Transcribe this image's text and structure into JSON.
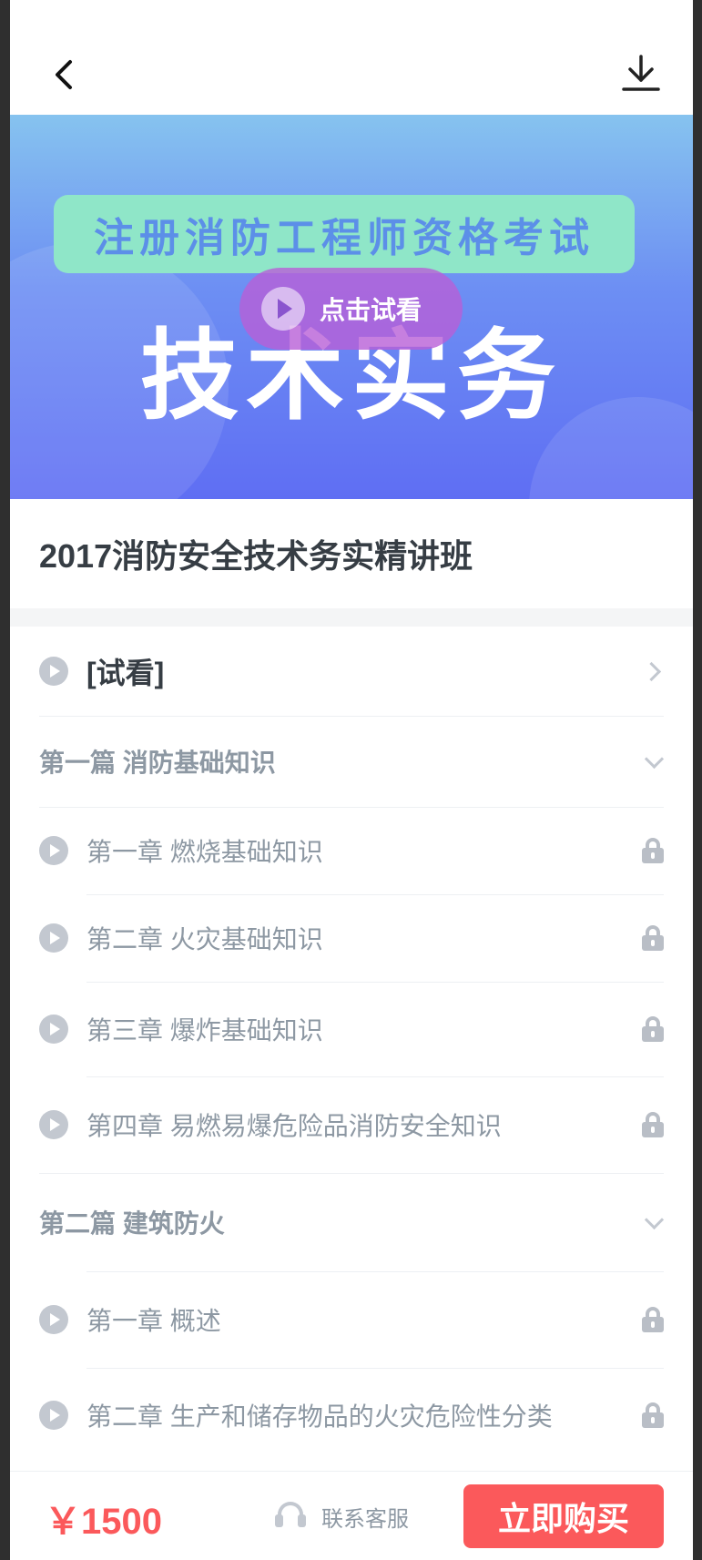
{
  "header": {
    "back_icon": "chevron-left-icon",
    "download_icon": "download-icon"
  },
  "banner": {
    "top_text": "注册消防工程师资格考试",
    "big_text": "技术实务",
    "trial_label": "点击试看",
    "trial_icon": "play-icon"
  },
  "course": {
    "title": "2017消防安全技术务实精讲班"
  },
  "list": {
    "trial_item": "[试看]",
    "part1": "第一篇  消防基础知识",
    "part1_ch1": "第一章  燃烧基础知识",
    "part1_ch2": "第二章  火灾基础知识",
    "part1_ch3": "第三章  爆炸基础知识",
    "part1_ch4": "第四章  易燃易爆危险品消防安全知识",
    "part2": "第二篇  建筑防火",
    "part2_ch1": "第一章  概述",
    "part2_ch2": "第二章  生产和储存物品的火灾危险性分类"
  },
  "bottom": {
    "price": "￥1500",
    "service_label": "联系客服",
    "service_icon": "headset-icon",
    "buy_label": "立即购买"
  },
  "colors": {
    "title": "#363d44",
    "text": "#8d98a3",
    "divider": "#edf0f3",
    "gap": "#f4f5f6",
    "price": "#fb595b",
    "buy_bg": "#fb595b"
  }
}
